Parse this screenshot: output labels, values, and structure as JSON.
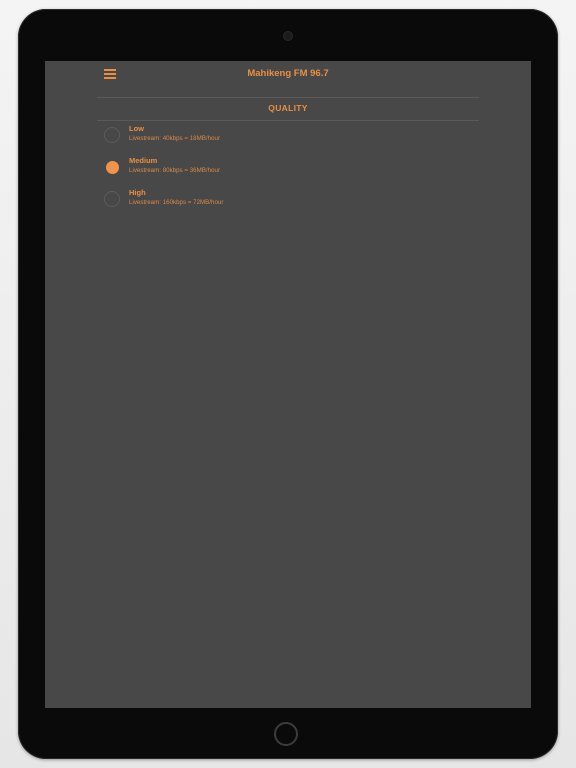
{
  "app": {
    "title": "Mahikeng FM 96.7"
  },
  "nav": {
    "menu_icon": "hamburger-menu-icon"
  },
  "section": {
    "title": "QUALITY"
  },
  "options": [
    {
      "label": "Low",
      "description": "Livestream: 40kbps = 18MB/hour",
      "selected": false
    },
    {
      "label": "Medium",
      "description": "Livestream: 80kbps = 36MB/hour",
      "selected": true
    },
    {
      "label": "High",
      "description": "Livestream: 160kbps = 72MB/hour",
      "selected": false
    }
  ],
  "colors": {
    "accent": "#e88f45",
    "screen_background": "#484848",
    "device_frame": "#0a0a0a"
  }
}
